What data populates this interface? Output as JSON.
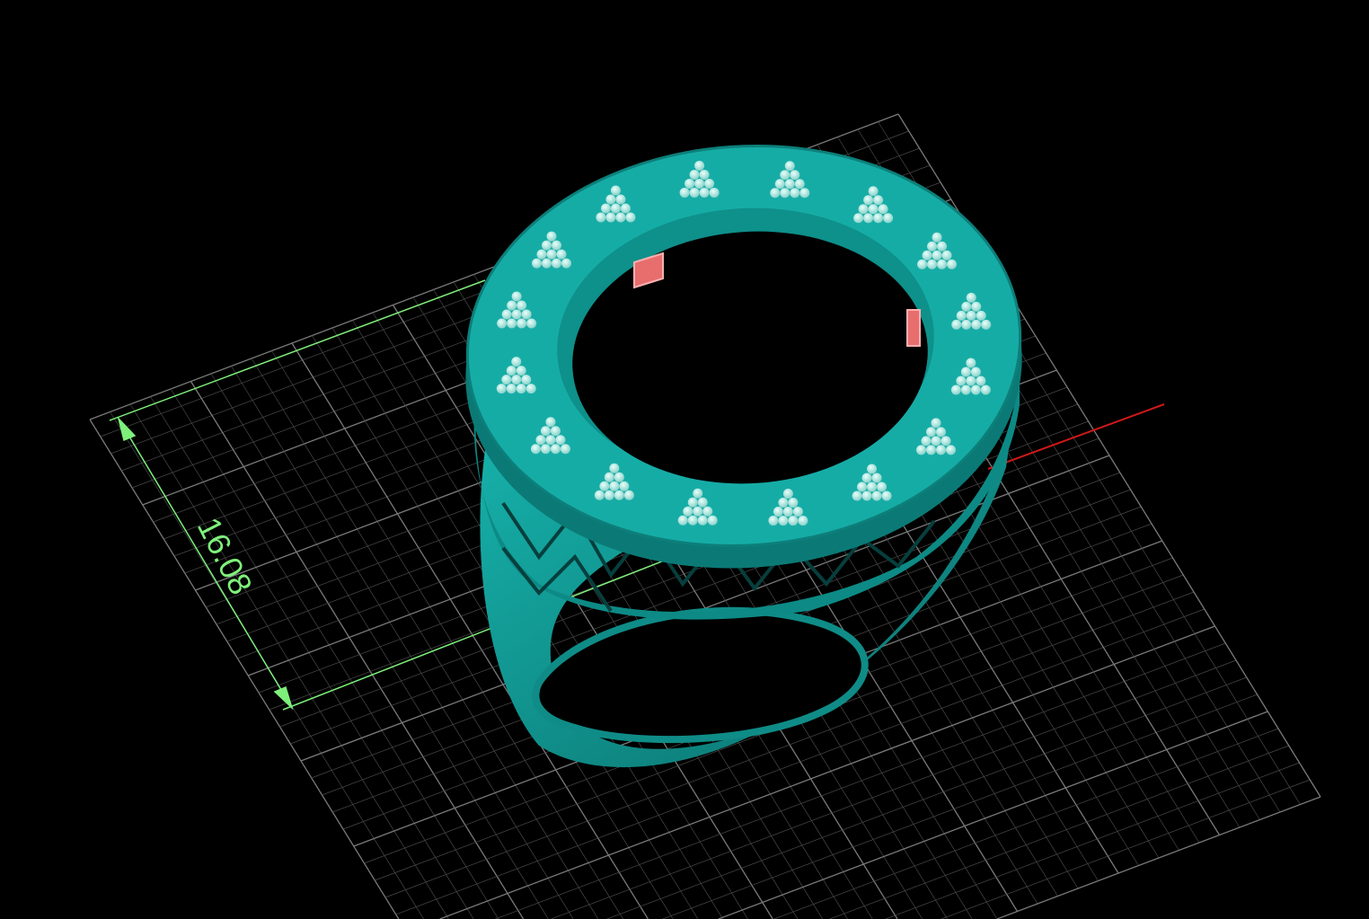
{
  "viewport": {
    "dimension_label": "16.08",
    "colors": {
      "background": "#000000",
      "grid": "#5a5a5a",
      "dimension": "#7ef07a",
      "x_axis": "#d01818",
      "model": "#13a6a0",
      "model_dark": "#0b6f6c",
      "stones": "#b8f0e8",
      "highlight": "#f07070"
    }
  }
}
